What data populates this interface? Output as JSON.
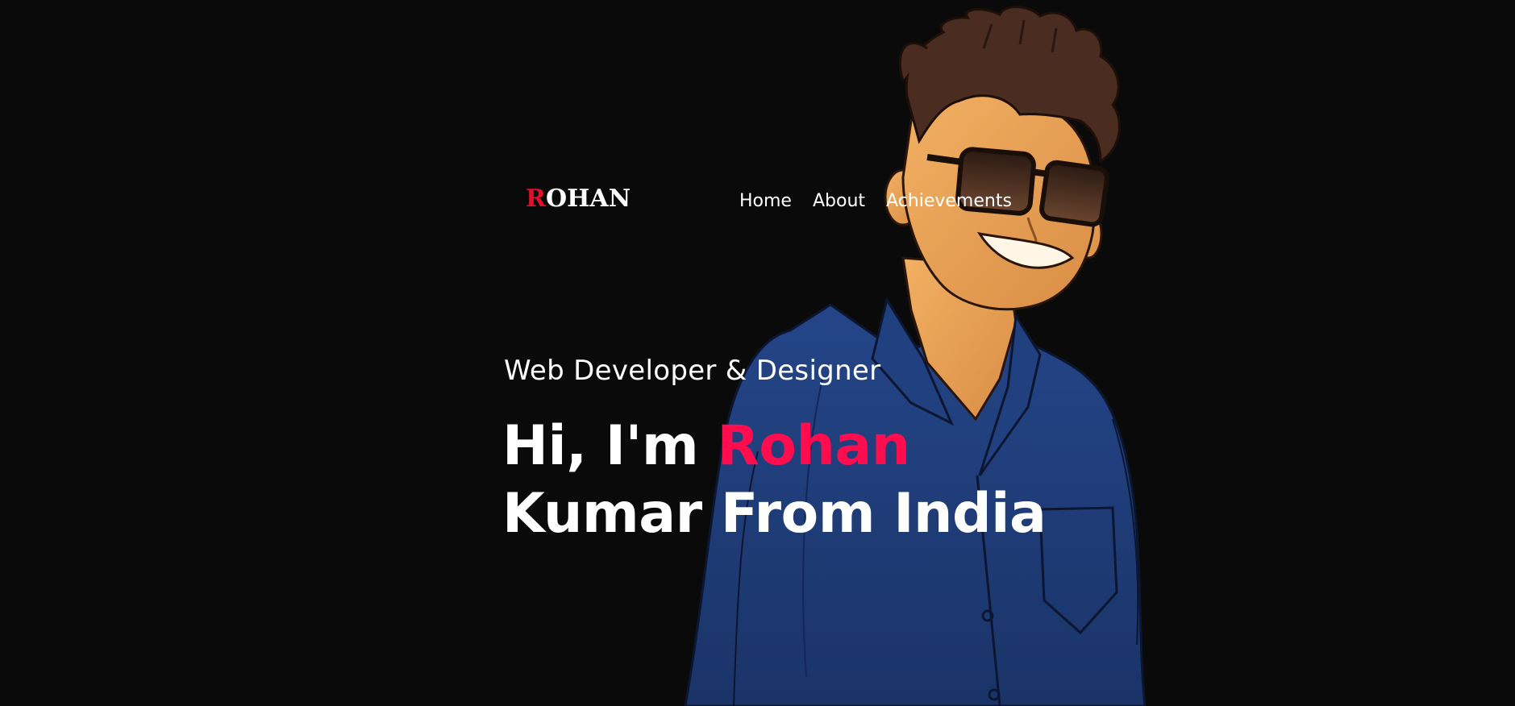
{
  "brand": {
    "initial": "R",
    "rest": "OHAN",
    "colors": {
      "initial": "#e0102a",
      "text": "#ffffff"
    }
  },
  "nav": {
    "items": [
      {
        "label": "Home"
      },
      {
        "label": "About"
      },
      {
        "label": "Achievements"
      }
    ]
  },
  "hero": {
    "subtitle": "Web Developer & Designer",
    "headline_prefix": "Hi, I'm ",
    "headline_name": "Rohan",
    "headline_line2": "Kumar From India",
    "accent_color": "#ff0d4f",
    "illustration": "cartoon-man-with-sunglasses-and-blue-shirt"
  },
  "colors": {
    "background": "#0a0a0a",
    "shirt": "#1f3c78",
    "skin": "#e9a558",
    "hair": "#4a2c20"
  }
}
